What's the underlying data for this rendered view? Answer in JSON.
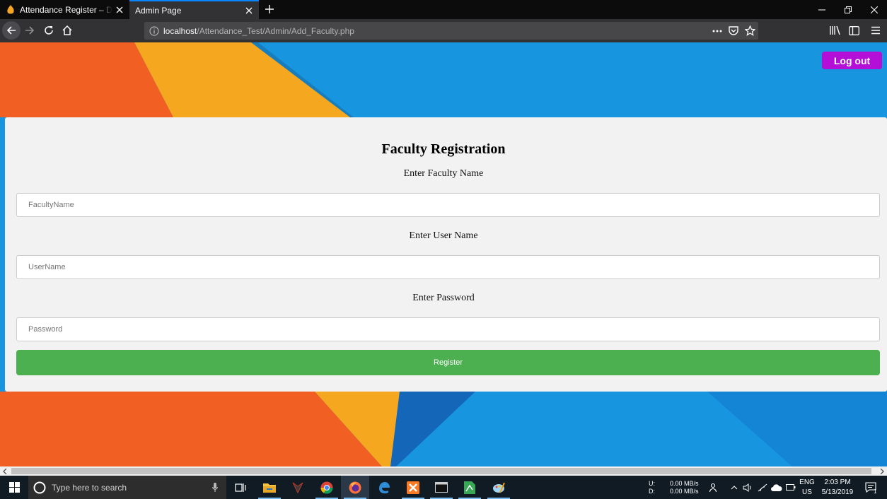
{
  "browser": {
    "tabs": [
      {
        "label": "Attendance Register – Database"
      },
      {
        "label": "Admin Page"
      }
    ],
    "url_host": "localhost",
    "url_path": "/Attendance_Test/Admin/Add_Faculty.php"
  },
  "page": {
    "logout_label": "Log out",
    "heading": "Faculty Registration",
    "fields": [
      {
        "label": "Enter Faculty Name",
        "placeholder": "FacultyName"
      },
      {
        "label": "Enter User Name",
        "placeholder": "UserName"
      },
      {
        "label": "Enter Password",
        "placeholder": "Password"
      }
    ],
    "register_label": "Register"
  },
  "taskbar": {
    "search_placeholder": "Type here to search",
    "net_up_label": "U:",
    "net_down_label": "D:",
    "net_up": "0.00 MB/s",
    "net_down": "0.00 MB/s",
    "lang": "ENG",
    "region": "US",
    "time": "2:03 PM",
    "date": "5/13/2019",
    "notification_count": "1"
  },
  "colors": {
    "logout": "#b30fd6",
    "register": "#4caf50",
    "accent": "#0a84ff"
  }
}
